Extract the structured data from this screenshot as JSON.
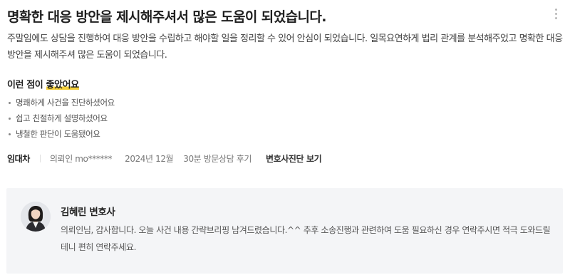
{
  "review": {
    "title": "명확한 대응 방안을 제시해주셔서 많은 도움이 되었습니다.",
    "body": "주말임에도 상담을 진행하여 대응 방안을 수립하고 해야할 일을 정리할 수 있어 안심이 되었습니다. 일목요연하게 법리 관계를 분석해주었고 명확한 대응 방안을 제시해주셔 많은 도움이 되었습니다."
  },
  "good_points": {
    "heading_prefix": "이런 점이 ",
    "heading_highlight": "좋았어요",
    "items": [
      "명쾌하게 사건을 진단하셨어요",
      "쉽고 친절하게 설명하셨어요",
      "냉철한 판단이 도움됐어요"
    ]
  },
  "meta": {
    "category": "임대차",
    "client": "의뢰인 mo******",
    "date": "2024년 12월",
    "consult_type": "30분 방문상담 후기",
    "diagnosis_link": "변호사진단 보기"
  },
  "reply": {
    "lawyer_name": "김혜린 변호사",
    "text": "의뢰인님, 감사합니다. 오늘 사건 내용 간략브리핑 남겨드렸습니다.^^ 추후 소송진행과 관련하여 도움 필요하신 경우 연락주시면 적극 도와드릴테니 편히 연락주세요."
  },
  "icons": {
    "more": "more-vertical-icon",
    "bullet": "bullet-dot-icon"
  },
  "colors": {
    "highlight": "#f4cf3a",
    "reply_background": "#f4f5f7"
  }
}
